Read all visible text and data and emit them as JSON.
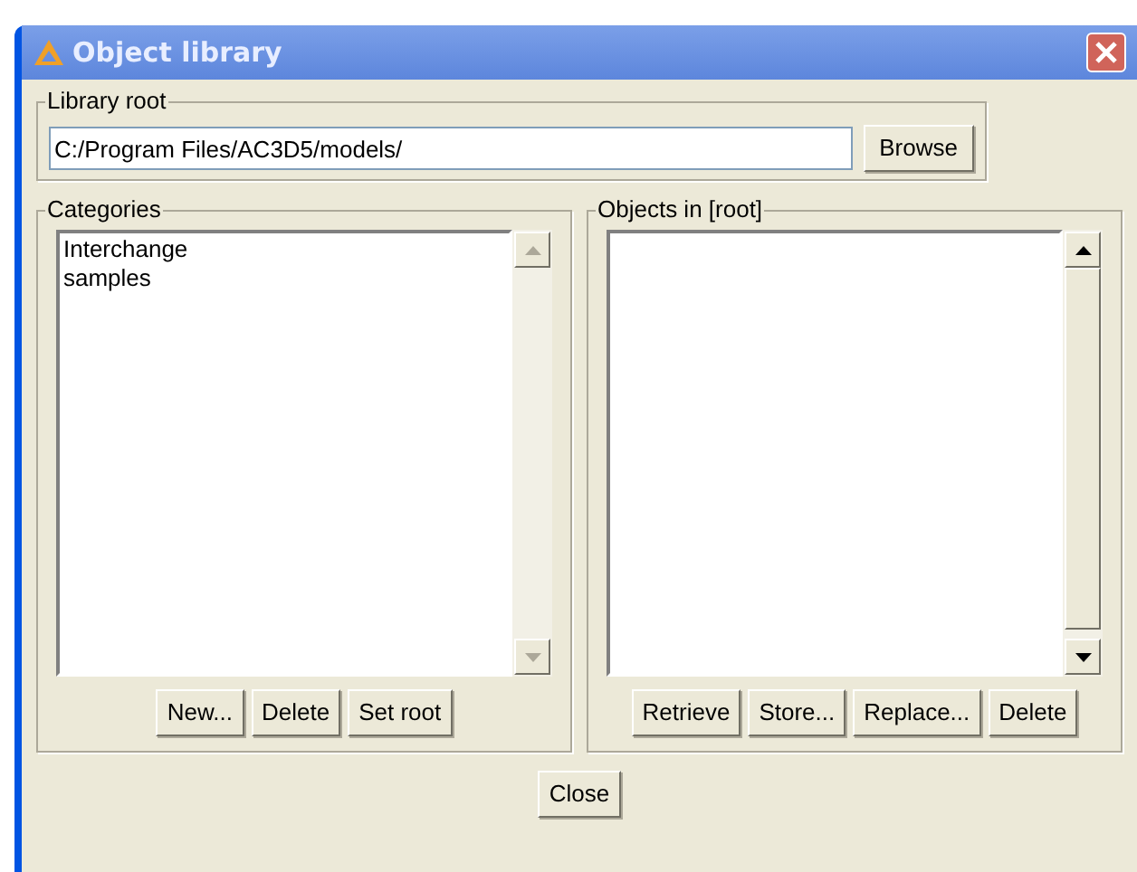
{
  "window": {
    "title": "Object library"
  },
  "library_root": {
    "label": "Library root",
    "value": "C:/Program Files/AC3D5/models/",
    "button": "Browse"
  },
  "categories": {
    "label": "Categories",
    "items": [
      "Interchange",
      "samples"
    ],
    "scroll_enabled": false,
    "buttons": [
      "New...",
      "Delete",
      "Set root"
    ]
  },
  "objects": {
    "label": "Objects in [root]",
    "scroll_enabled": true,
    "buttons": [
      "Retrieve",
      "Store...",
      "Replace...",
      "Delete"
    ]
  },
  "close_button": "Close"
}
